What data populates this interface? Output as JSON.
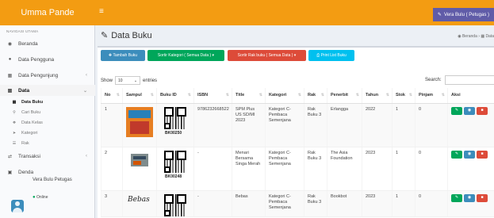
{
  "app": {
    "brand": "Umma Pande",
    "user_button": "Vera Bulu ( Petugas )"
  },
  "sidebar": {
    "header": "NAVIGASI UTAMA",
    "items": [
      {
        "label": "Beranda",
        "icon": "dashboard-icon"
      },
      {
        "label": "Data Pengguna",
        "icon": "users-icon"
      },
      {
        "label": "Data Pengunjung",
        "icon": "book-icon"
      },
      {
        "label": "Data",
        "icon": "book-icon"
      },
      {
        "label": "Transaksi",
        "icon": "exchange-icon"
      },
      {
        "label": "Denda",
        "icon": "money-icon"
      }
    ],
    "subitems": [
      {
        "label": "Data Buku",
        "icon": "book-icon"
      },
      {
        "label": "Cari Buku",
        "icon": "search-icon"
      },
      {
        "label": "Data Kelas",
        "icon": "tags-icon"
      },
      {
        "label": "Kategori",
        "icon": "tag-icon"
      },
      {
        "label": "Rak",
        "icon": "list-icon"
      }
    ],
    "user": {
      "name": "Vera Bulu Petugas",
      "status": "Online"
    }
  },
  "page": {
    "title": "Data Buku",
    "breadcrumb": [
      "Beranda",
      "Data"
    ]
  },
  "toolbar": {
    "add": "Tambah Buku",
    "sort_category": "Sortir Kategori ( Semua Data )",
    "sort_shelf": "Sortir Rak buku ( Semua Data )",
    "print": "Print List Buku"
  },
  "table_controls": {
    "show_label": "Show",
    "show_value": "10",
    "entries_label": "entries",
    "search_label": "Search:"
  },
  "table": {
    "columns": [
      "No",
      "Sampul",
      "Buku ID",
      "ISBN",
      "Title",
      "Kategori",
      "Rak",
      "Penerbit",
      "Tahun",
      "Stok",
      "Pinjam",
      "Aksi"
    ],
    "rows": [
      {
        "no": "1",
        "book_id": "BK00250",
        "isbn": "9786232668522",
        "title": "SPM Plus US SD/MI 2023",
        "category": "Kategori C-Pembaca Semenjana",
        "shelf": "Rak Buku 3",
        "publisher": "Erlangga",
        "year": "2022",
        "stock": "1",
        "borrowed": "0"
      },
      {
        "no": "2",
        "book_id": "BK00248",
        "isbn": "-",
        "title": "Menari Bersama Singa Merah",
        "category": "Kategori C-Pembaca Semenjana",
        "shelf": "Rak Buku 3",
        "publisher": "The Asia Foundation",
        "year": "2023",
        "stock": "1",
        "borrowed": "0"
      },
      {
        "no": "3",
        "book_id": "",
        "isbn": "-",
        "title": "Bebas",
        "category": "Kategori C-Pembaca Semenjana",
        "shelf": "Rak Buku 3",
        "publisher": "Bookbot",
        "year": "2023",
        "stock": "1",
        "borrowed": "0",
        "cover_text": "Bebas"
      }
    ]
  },
  "colors": {
    "topbar": "#f39c12",
    "user_button": "#605ca8",
    "add": "#3c8dbc",
    "sort_category": "#00a65a",
    "sort_shelf": "#dd4b39",
    "print": "#00c0ef"
  }
}
